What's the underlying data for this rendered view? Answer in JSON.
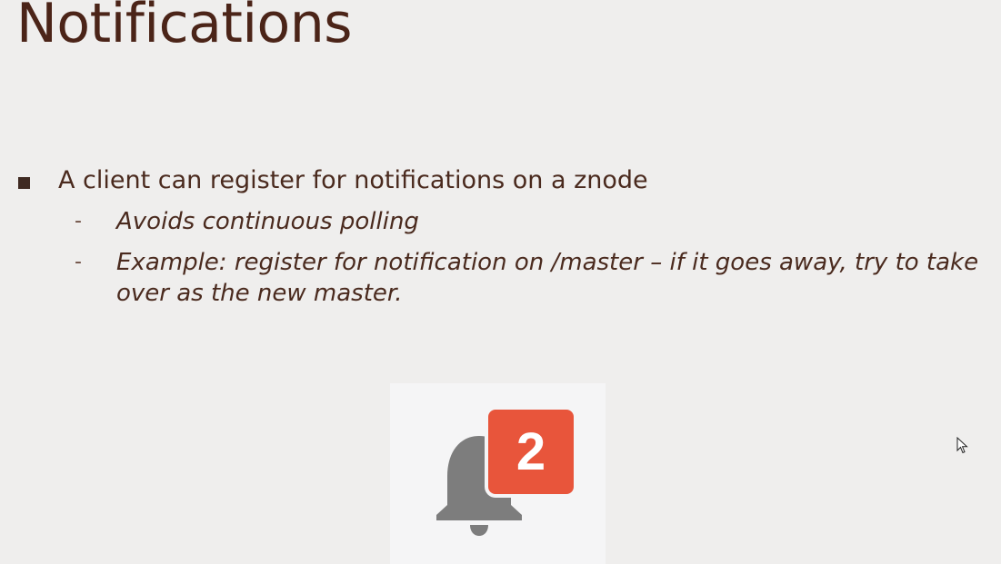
{
  "slide": {
    "title": "Notifications",
    "bullet": "A client can register for notifications on a znode",
    "sub_items": [
      {
        "marker": "-",
        "text": "Avoids continuous polling"
      },
      {
        "marker": "-",
        "text": "Example: register for notification on /master – if it goes away, try to take over as the new master."
      }
    ]
  },
  "notification_icon": {
    "icon": "bell-icon",
    "badge_count": "2",
    "badge_color": "#e8553b",
    "bell_color": "#7d7d7d"
  },
  "cursor": {
    "icon": "mouse-pointer-icon"
  }
}
